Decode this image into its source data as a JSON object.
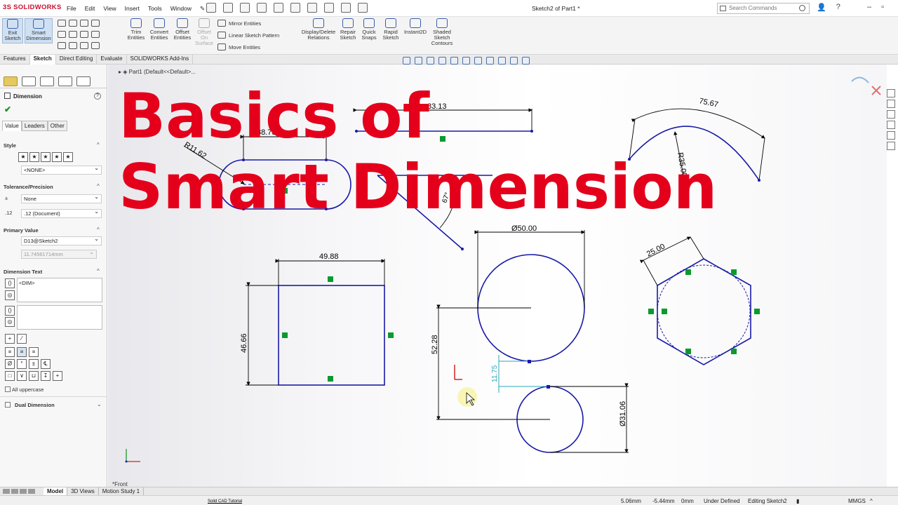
{
  "app": {
    "logo": "3S SOLIDWORKS",
    "doc_title": "Sketch2 of Part1 *",
    "search_placeholder": "Search Commands"
  },
  "menu": [
    "File",
    "Edit",
    "View",
    "Insert",
    "Tools",
    "Window"
  ],
  "ribbon": {
    "exit_sketch": "Exit Sketch",
    "smart_dimension": "Smart Dimension",
    "trim": "Trim Entities",
    "convert": "Convert Entities",
    "offset": "Offset Entities",
    "offset_surface": "Offset On Surface",
    "mirror": "Mirror Entities",
    "linear_pattern": "Linear Sketch Pattern",
    "move": "Move Entities",
    "display_relations": "Display/Delete Relations",
    "repair": "Repair Sketch",
    "quick_snaps": "Quick Snaps",
    "rapid": "Rapid Sketch",
    "instant2d": "Instant2D",
    "shaded": "Shaded Sketch Contours"
  },
  "tabs": [
    "Features",
    "Sketch",
    "Direct Editing",
    "Evaluate",
    "SOLIDWORKS Add-Ins"
  ],
  "tree": {
    "part": "Part1  (Default<<Default>..."
  },
  "property_manager": {
    "title": "Dimension",
    "subtabs": [
      "Value",
      "Leaders",
      "Other"
    ],
    "style_label": "Style",
    "style_value": "<NONE>",
    "tolerance_label": "Tolerance/Precision",
    "tolerance_value": "None",
    "precision_value": ".12 (Document)",
    "primary_label": "Primary Value",
    "primary_name": "D13@Sketch2",
    "primary_value": "11.74561714mm",
    "dimtext_label": "Dimension Text",
    "dimtext_value": "<DIM>",
    "uppercase_label": "All uppercase",
    "dual_label": "Dual Dimension"
  },
  "overlay": {
    "line1": "Basics of",
    "line2": "Smart Dimension"
  },
  "dimensions": {
    "top_line": "83.13",
    "slot_len": "38.75",
    "slot_r": "R11.62",
    "arc_len": "75.67",
    "arc_r": "R35.00",
    "square_w": "49.88",
    "square_h": "46.66",
    "circle_big": "Ø50.00",
    "vert_5228": "52.28",
    "gap_1175": "11.75",
    "circle_small": "Ø31.06",
    "hex_side": "25.00",
    "angle": "67°"
  },
  "view_label": "*Front",
  "bottom_tabs": [
    "Model",
    "3D Views",
    "Motion Study 1"
  ],
  "watermark": "Solid CAD Tutorial",
  "status": {
    "x": "5.06mm",
    "y": "-5.44mm",
    "z": "0mm",
    "defined": "Under Defined",
    "editing": "Editing Sketch2",
    "units": "MMGS"
  },
  "colors": {
    "sketch_blue": "#1a1aa8",
    "overlay_red": "#e4001b",
    "relation_green": "#0a9a2e"
  }
}
